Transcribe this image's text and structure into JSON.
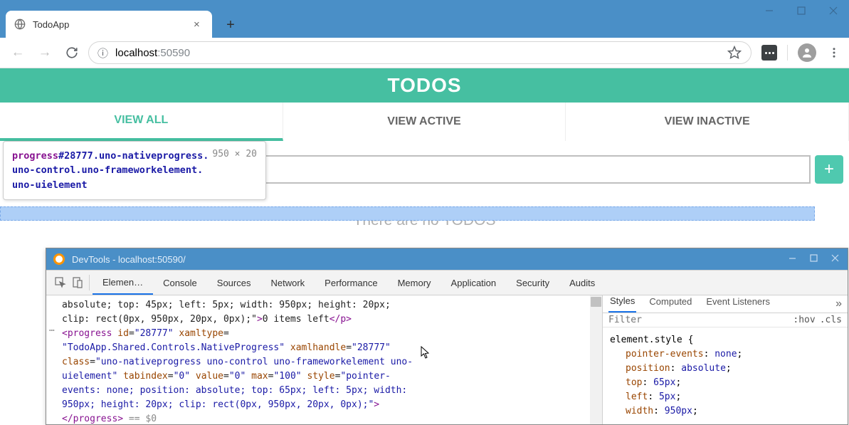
{
  "browser": {
    "tab_title": "TodoApp",
    "url_host": "localhost",
    "url_port": ":50590"
  },
  "app": {
    "title": "TODOS",
    "tabs": [
      {
        "label": "VIEW ALL",
        "active": true
      },
      {
        "label": "VIEW ACTIVE",
        "active": false
      },
      {
        "label": "VIEW INACTIVE",
        "active": false
      }
    ],
    "items_left": "0 items left",
    "empty_text": "There are no TODOS"
  },
  "inspect_tooltip": {
    "tag": "progress",
    "id": "#28777",
    "classes": ".uno-nativeprogress.uno-control.uno-frameworkelement.uno-uielement",
    "class_line1": ".uno-nativeprogress.",
    "class_line2": "uno-control.uno-frameworkelement.",
    "class_line3": "uno-uielement",
    "dimensions": "950 × 20"
  },
  "devtools": {
    "window_title": "DevTools - localhost:50590/",
    "tabs": [
      "Elemen…",
      "Console",
      "Sources",
      "Network",
      "Performance",
      "Memory",
      "Application",
      "Security",
      "Audits"
    ],
    "active_tab": 0,
    "code_lines": [
      {
        "pre": "absolute; top: 45px; left: 5px; width: 950px; height: 20px; clip: rect(0px, 950px, 20px, 0px);\">",
        "text": "0 items left",
        "close": "</p>"
      },
      {
        "open_tag": "<progress",
        "attrs": [
          [
            "id",
            "28777"
          ],
          [
            "xamltype",
            ""
          ]
        ]
      },
      {
        "val": "TodoApp.Shared.Controls.NativeProgress",
        "attrs2": [
          [
            "xamlhandle",
            "28777"
          ]
        ]
      },
      {
        "attr": "class",
        "aval": "uno-nativeprogress uno-control uno-frameworkelement uno-uielement",
        "wrap_start": "uno-nativeprogress uno-control uno-frameworkelement uno-"
      },
      {
        "wrap_end": "uielement",
        "attrs3": [
          [
            "tabindex",
            "0"
          ],
          [
            "value",
            "0"
          ],
          [
            "max",
            "100"
          ]
        ],
        "style_start": "pointer-"
      },
      {
        "style_cont": "events: none; position: absolute; top: 65px; left: 5px; width: 950px; height: 20px; clip: rect(0px, 950px, 20px, 0px);\">"
      },
      {
        "close_tag": "</progress>",
        "eq": " == $0"
      }
    ],
    "styles_tabs": [
      "Styles",
      "Computed",
      "Event Listeners"
    ],
    "styles_active": 0,
    "filter_placeholder": "Filter",
    "filter_opts": [
      ":hov",
      ".cls"
    ],
    "element_style_label": "element.style {",
    "rules": [
      {
        "prop": "pointer-events",
        "val": "none"
      },
      {
        "prop": "position",
        "val": "absolute"
      },
      {
        "prop": "top",
        "val": "65px"
      },
      {
        "prop": "left",
        "val": "5px"
      },
      {
        "prop": "width",
        "val": "950px"
      }
    ]
  }
}
